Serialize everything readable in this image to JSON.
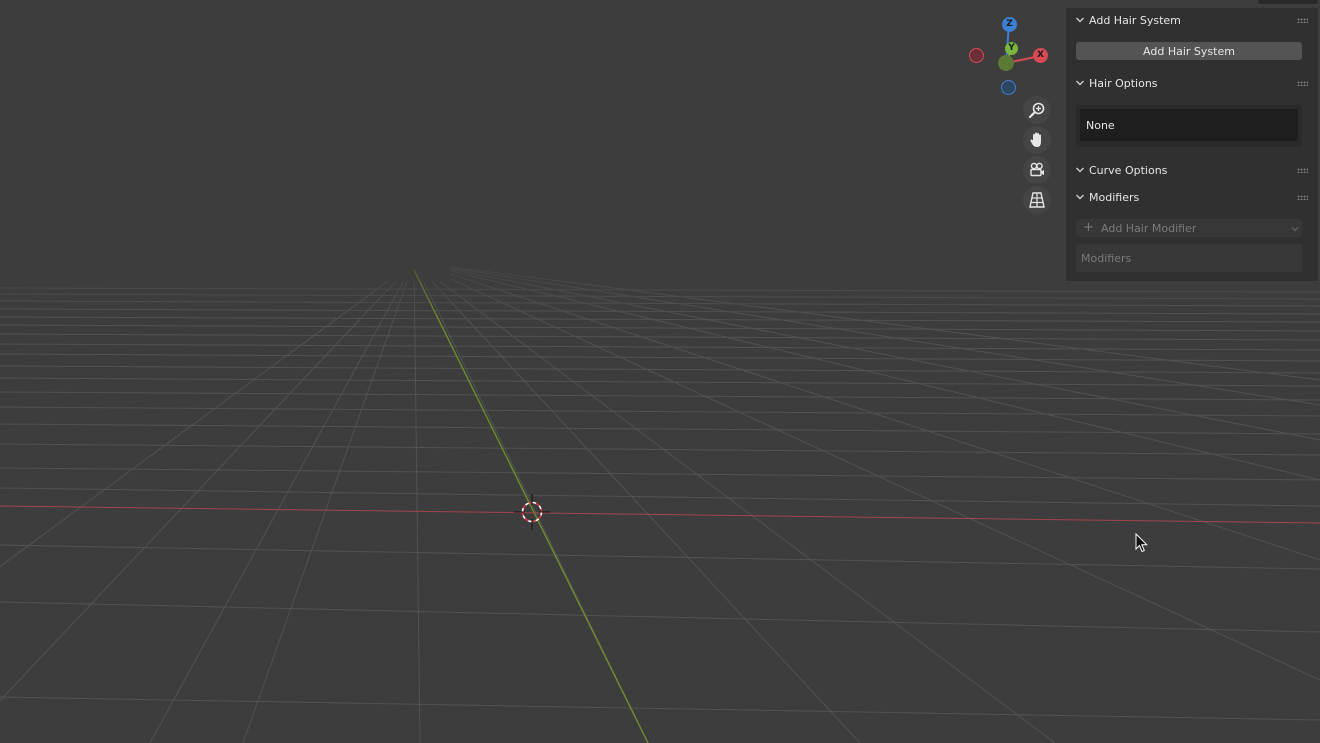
{
  "gizmo": {
    "z_label": "Z",
    "y_label": "Y",
    "x_label": "X",
    "colors": {
      "x": "#d94a55",
      "y": "#6fa83a",
      "z": "#3d7fd1",
      "x_neg": "#8e3540",
      "z_neg": "#345a86"
    }
  },
  "nav_buttons": [
    {
      "icon": "zoom-icon"
    },
    {
      "icon": "hand-pan-icon"
    },
    {
      "icon": "camera-view-icon"
    },
    {
      "icon": "perspective-grid-icon"
    }
  ],
  "sidebar": {
    "add_hair_system": {
      "title": "Add Hair System",
      "button_label": "Add Hair System"
    },
    "hair_options": {
      "title": "Hair Options",
      "value": "None"
    },
    "curve_options": {
      "title": "Curve Options"
    },
    "modifiers": {
      "title": "Modifiers",
      "add_label": "Add Hair Modifier",
      "list_label": "Modifiers"
    }
  },
  "colors": {
    "viewport_bg": "#3d3d3d",
    "panel_bg": "#303030",
    "x_axis": "#a2464d",
    "y_axis": "#6e8c2c"
  }
}
